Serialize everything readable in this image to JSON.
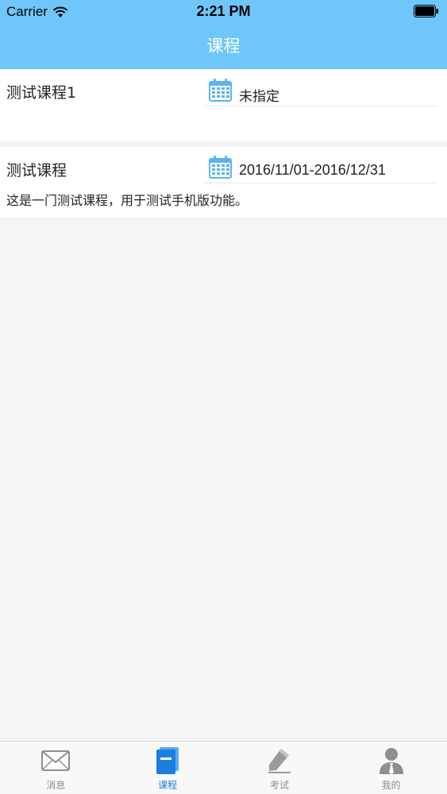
{
  "status_bar": {
    "carrier": "Carrier",
    "time": "2:21 PM"
  },
  "nav": {
    "title": "课程"
  },
  "courses": [
    {
      "name": "测试课程1",
      "date": "未指定",
      "description": ""
    },
    {
      "name": "测试课程",
      "date": "2016/11/01-2016/12/31",
      "description": "这是一门测试课程，用于测试手机版功能。"
    }
  ],
  "tabs": [
    {
      "label": "消息",
      "icon": "envelope-icon",
      "active": false
    },
    {
      "label": "课程",
      "icon": "book-icon",
      "active": true
    },
    {
      "label": "考试",
      "icon": "pencil-icon",
      "active": false
    },
    {
      "label": "我的",
      "icon": "person-icon",
      "active": false
    }
  ],
  "colors": {
    "nav_background": "#6fc6fa",
    "tab_active": "#1b7fe0",
    "tab_inactive": "#8e8e8e",
    "calendar_icon": "#5bb3f0",
    "page_background": "#f4f3f5"
  }
}
